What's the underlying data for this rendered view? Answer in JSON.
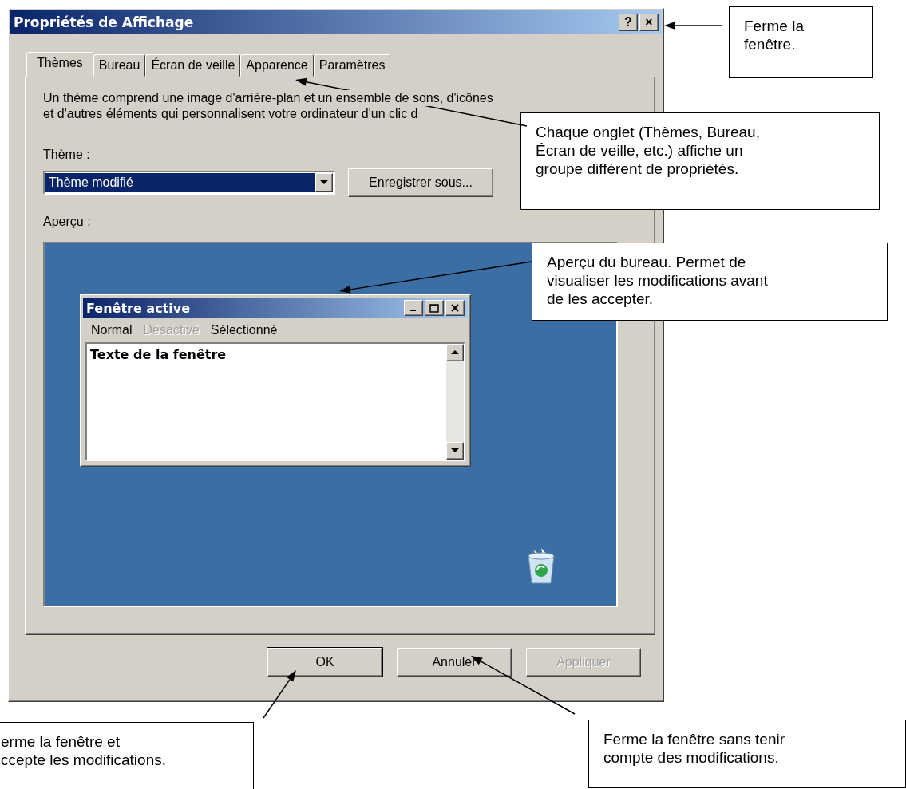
{
  "window": {
    "title": "Propriétés de Affichage",
    "title_buttons": [
      "?",
      "×"
    ]
  },
  "tabs": [
    {
      "label": "Thèmes",
      "selected": true
    },
    {
      "label": "Bureau",
      "selected": false
    },
    {
      "label": "Écran de veille",
      "selected": false
    },
    {
      "label": "Apparence",
      "selected": false
    },
    {
      "label": "Paramètres",
      "selected": false
    }
  ],
  "description_lines": [
    "Un thème comprend une image d'arrière-plan et un ensemble de sons, d'icônes",
    "et d'autres éléments qui personnalisent votre ordinateur d'un clic d"
  ],
  "theme_label": "Thème :",
  "theme_select": {
    "value": "Thème modifié"
  },
  "theme_buttons": [
    {
      "label": "Enregistrer sous...",
      "disabled": false
    }
  ],
  "preview_label": "Aperçu :",
  "preview": {
    "window_title": "Fenêtre active",
    "menu": [
      {
        "label": "Normal",
        "disabled": false
      },
      {
        "label": "Désactivé",
        "disabled": true
      },
      {
        "label": "Sélectionné",
        "disabled": false
      }
    ],
    "text": "Texte de la fenêtre"
  },
  "dialog_buttons": [
    {
      "label": "OK",
      "default": true,
      "disabled": false
    },
    {
      "label": "Annuler",
      "default": false,
      "disabled": false
    },
    {
      "label": "Appliquer",
      "default": false,
      "disabled": true
    }
  ],
  "callouts": [
    {
      "lines": [
        "Ferme la",
        "fenêtre."
      ]
    },
    {
      "lines": [
        "Chaque onglet (Thèmes, Bureau,",
        "Écran de veille, etc.) affiche un",
        "groupe différent de propriétés."
      ]
    },
    {
      "lines": [
        "Aperçu du bureau. Permet de",
        "visualiser les modifications avant",
        "de les accepter."
      ]
    },
    {
      "lines": [
        "erme la fenêtre et",
        "ccepte les modifications."
      ]
    },
    {
      "lines": [
        "Ferme la fenêtre sans tenir",
        "compte des modifications."
      ]
    }
  ]
}
